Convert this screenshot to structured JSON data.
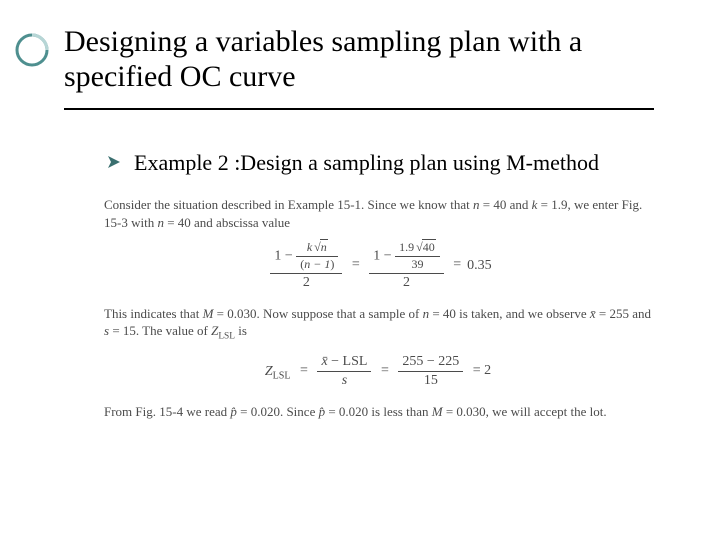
{
  "title": "Designing a variables sampling plan with a specified OC curve",
  "bullet1": "Example 2 :Design a sampling plan using M-method",
  "body": {
    "p1_pre": "Consider the situation described in Example 15-1. Since we know that ",
    "p1_n": "n",
    "p1_neq": " = 40 and ",
    "p1_k": "k",
    "p1_keq": " = 1.9, we enter Fig. 15-3 with ",
    "p1_n2": "n",
    "p1_tail": " = 40 and abscissa value",
    "eq1": {
      "lhs_num_pre": "1 − ",
      "k": "k",
      "n": "n",
      "lhs_den_pre": "(",
      "nminus": "n − 1",
      "lhs_den_post": ")",
      "over2": "2",
      "mid_num": "1 − ",
      "kval": "1.9",
      "sqrt40": "40",
      "mid_den": "39",
      "eq": " = ",
      "res": "0.35"
    },
    "p2_pre": "This indicates that ",
    "p2_M": "M",
    "p2_meq": " = 0.030. Now suppose that a sample of ",
    "p2_n": "n",
    "p2_neq": " = 40 is taken, and we observe ",
    "p2_xbar": "x̄",
    "p2_xval": " = 255 and ",
    "p2_s": "s",
    "p2_sval": " = 15. The value of ",
    "p2_z": "Z",
    "p2_lsl": "LSL",
    "p2_end": " is",
    "eq2": {
      "zl": "Z",
      "lsl": "LSL",
      "eq": " = ",
      "num1_xbar": "x̄",
      "num1_mid": " − LSL",
      "den1": "s",
      "num2": "255 − 225",
      "den2": "15",
      "res": " = 2"
    },
    "p3_pre": "From Fig. 15-4 we read ",
    "p3_phat": "p̂",
    "p3_mid": " = 0.020. Since ",
    "p3_phat2": "p̂",
    "p3_mid2": " = 0.020 is less than ",
    "p3_M": "M",
    "p3_tail": " = 0.030, we will accept the lot."
  }
}
